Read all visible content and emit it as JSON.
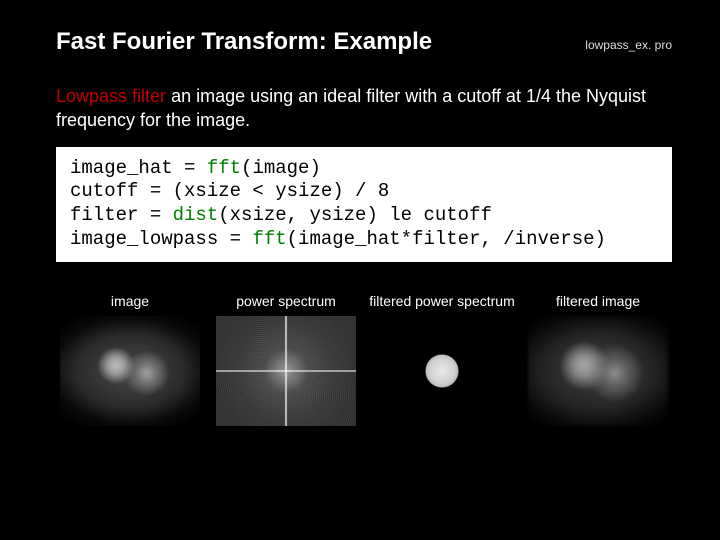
{
  "header": {
    "title": "Fast Fourier Transform: Example",
    "filename": "lowpass_ex. pro"
  },
  "intro": {
    "highlight": "Lowpass filter",
    "rest": " an image using an ideal filter with a cutoff at 1/4 the Nyquist frequency for the image."
  },
  "code": {
    "l1a": "image_hat = ",
    "l1fn": "fft",
    "l1b": "(image)",
    "l2": "cutoff = (xsize < ysize) / 8",
    "l3a": "filter = ",
    "l3fn": "dist",
    "l3b": "(xsize, ysize) le cutoff",
    "l4a": "image_lowpass = ",
    "l4fn": "fft",
    "l4b": "(image_hat*filter, /inverse)"
  },
  "thumbs": {
    "c1": "image",
    "c2": "power spectrum",
    "c3": "filtered\npower spectrum",
    "c4": "filtered image"
  }
}
